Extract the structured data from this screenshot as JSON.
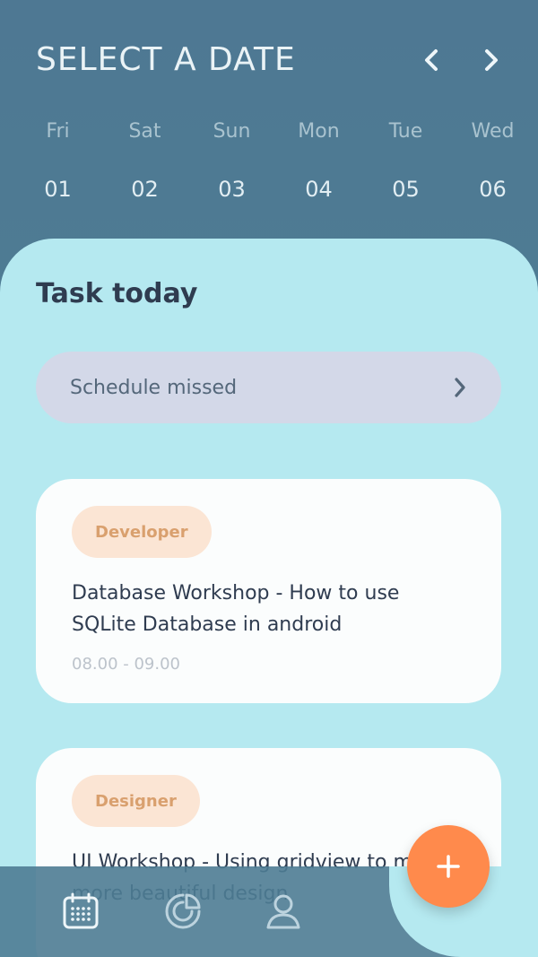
{
  "header": {
    "title": "SELECT A DATE"
  },
  "days": [
    {
      "name": "Fri",
      "num": "01"
    },
    {
      "name": "Sat",
      "num": "02"
    },
    {
      "name": "Sun",
      "num": "03"
    },
    {
      "name": "Mon",
      "num": "04"
    },
    {
      "name": "Tue",
      "num": "05"
    },
    {
      "name": "Wed",
      "num": "06"
    }
  ],
  "tasks": {
    "title": "Task today",
    "missed_label": "Schedule missed",
    "items": [
      {
        "tag": "Developer",
        "title": "Database Workshop - How to use SQLite Database in android",
        "time": "08.00 - 09.00"
      },
      {
        "tag": "Designer",
        "title": "UI Workshop - Using gridview to make more beautiful design",
        "time": ""
      }
    ]
  },
  "icons": {
    "prev": "chevron-left-icon",
    "next": "chevron-right-icon",
    "missed": "chevron-right-icon",
    "nav_calendar": "calendar-icon",
    "nav_stats": "chart-icon",
    "nav_profile": "user-icon",
    "fab": "plus-icon"
  },
  "colors": {
    "header_bg": "#4e7893",
    "panel_bg": "#b5e9f0",
    "accent": "#ff8a4c",
    "tag_bg": "#fbe5d4",
    "tag_text": "#d9a06e"
  }
}
